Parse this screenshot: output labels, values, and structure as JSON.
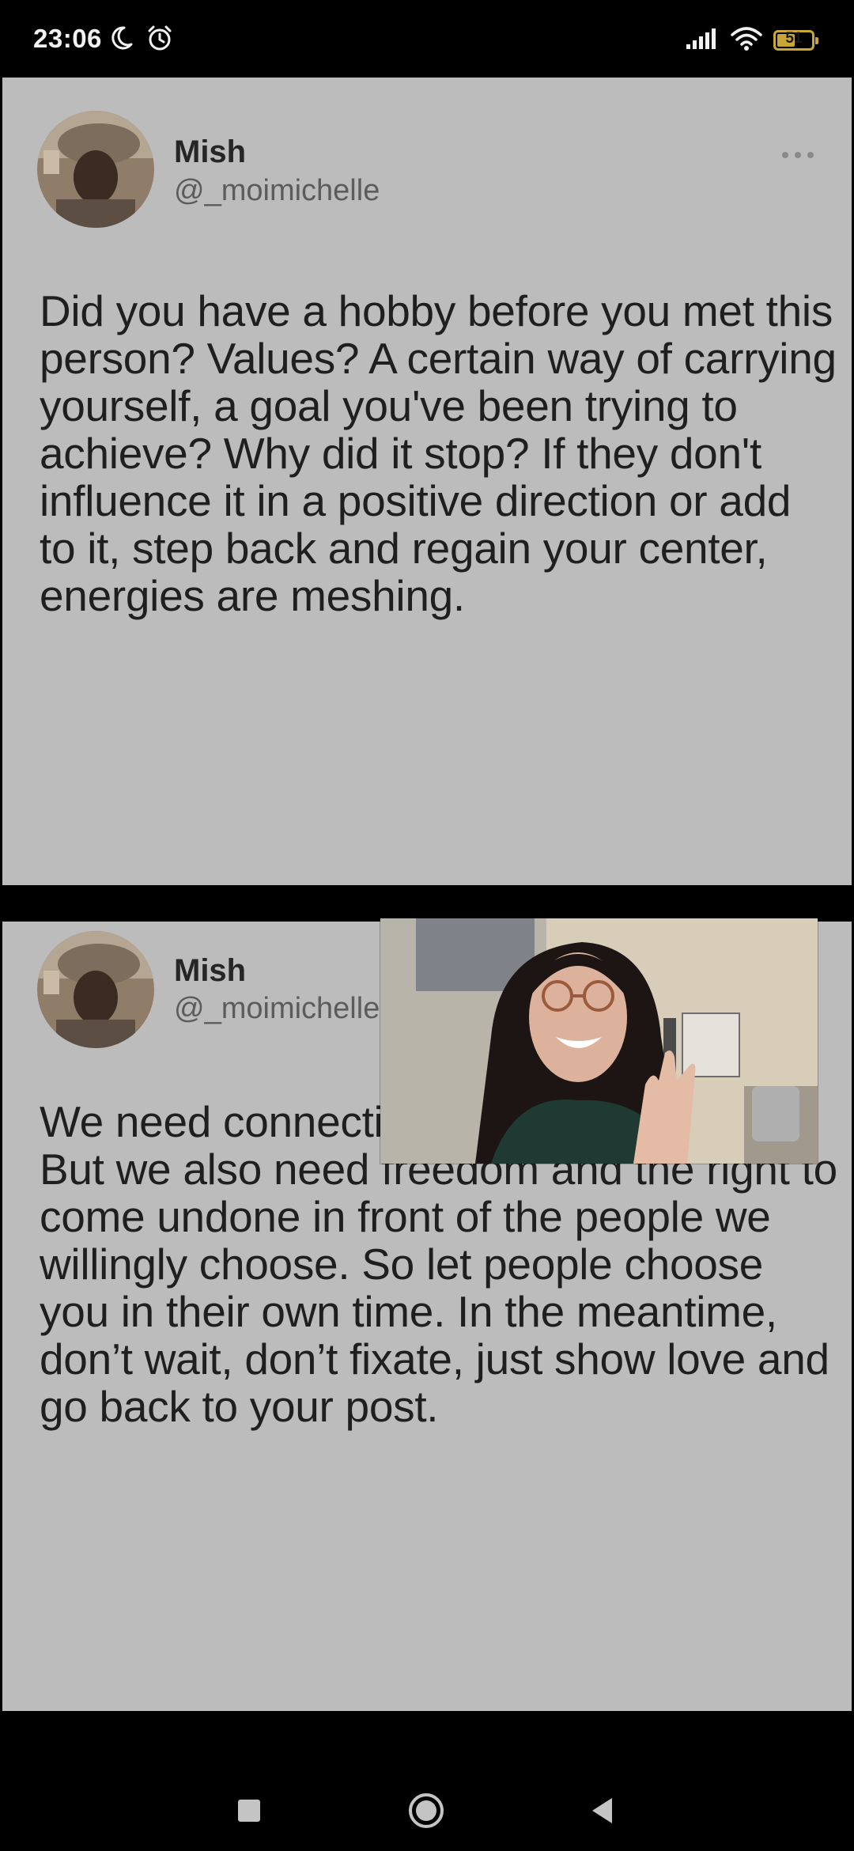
{
  "status_bar": {
    "time": "23:06",
    "battery": "51",
    "icons": [
      "moon-icon",
      "alarm-icon",
      "signal-icon",
      "wifi-icon",
      "battery-icon"
    ]
  },
  "tweets": [
    {
      "author_name": "Mish",
      "author_handle": "@_moimichelle",
      "text": "Did you have a hobby before you met this person? Values? A certain way of carrying yourself, a goal you've been trying to achieve? Why did it stop? If they don't influence it in a positive direction or add to it, step back and regain your center, energies are meshing."
    },
    {
      "author_name": "Mish",
      "author_handle": "@_moimichelle",
      "text": "We need connection. We need affection. But we also need freedom and the right to come undone in front of the people we willingly choose. So let people choose you in their own time. In the meantime, don’t wait, don’t fixate, just show love and go back to your post."
    }
  ],
  "nav_bar": {
    "icons": [
      "recents-icon",
      "home-icon",
      "back-icon"
    ]
  },
  "colors": {
    "card_background": "#bcbcbc",
    "text": "#1f1f1f",
    "handle": "#5c5c5c",
    "battery_accent": "#c9a735"
  }
}
